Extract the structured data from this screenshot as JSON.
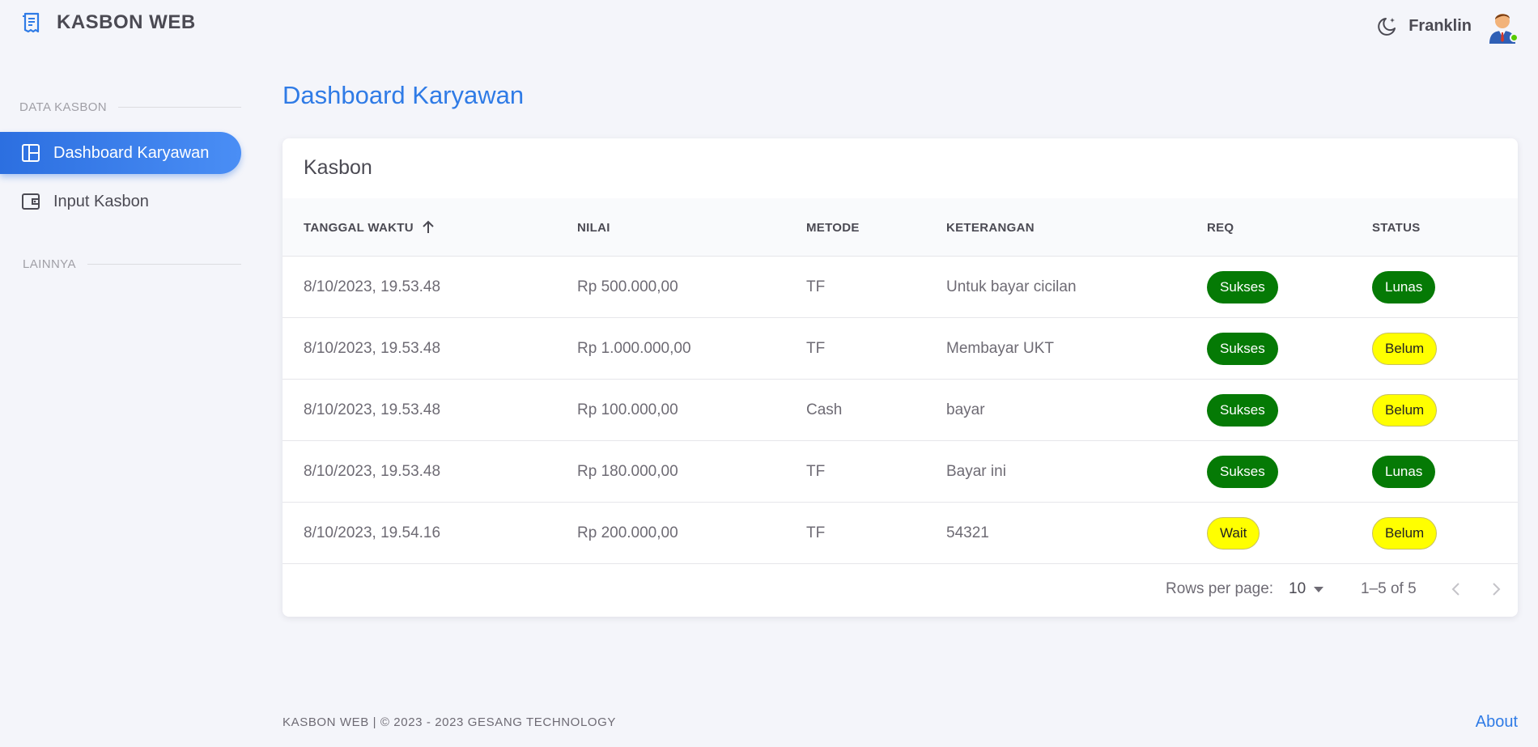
{
  "app": {
    "title": "KASBON WEB"
  },
  "user": {
    "name": "Franklin",
    "status_color": "#56ca00"
  },
  "sidebar": {
    "sections": [
      {
        "title": "DATA KASBON"
      },
      {
        "title": "LAINNYA"
      }
    ],
    "items": [
      {
        "label": "Dashboard Karyawan",
        "icon": "dashboard-icon",
        "active": true
      },
      {
        "label": "Input Kasbon",
        "icon": "wallet-icon",
        "active": false
      }
    ]
  },
  "page": {
    "title": "Dashboard Karyawan"
  },
  "table": {
    "title": "Kasbon",
    "columns": [
      "TANGGAL WAKTU",
      "NILAI",
      "METODE",
      "KETERANGAN",
      "REQ",
      "STATUS"
    ],
    "sort": {
      "column": "TANGGAL WAKTU",
      "direction": "asc"
    },
    "rows": [
      {
        "tanggal": "8/10/2023, 19.53.48",
        "nilai": "Rp 500.000,00",
        "metode": "TF",
        "keterangan": "Untuk bayar cicilan",
        "req": "Sukses",
        "status": "Lunas"
      },
      {
        "tanggal": "8/10/2023, 19.53.48",
        "nilai": "Rp 1.000.000,00",
        "metode": "TF",
        "keterangan": "Membayar UKT",
        "req": "Sukses",
        "status": "Belum"
      },
      {
        "tanggal": "8/10/2023, 19.53.48",
        "nilai": "Rp 100.000,00",
        "metode": "Cash",
        "keterangan": "bayar",
        "req": "Sukses",
        "status": "Belum"
      },
      {
        "tanggal": "8/10/2023, 19.53.48",
        "nilai": "Rp 180.000,00",
        "metode": "TF",
        "keterangan": "Bayar ini",
        "req": "Sukses",
        "status": "Lunas"
      },
      {
        "tanggal": "8/10/2023, 19.54.16",
        "nilai": "Rp 200.000,00",
        "metode": "TF",
        "keterangan": "54321",
        "req": "Wait",
        "status": "Belum"
      }
    ],
    "pagination": {
      "rows_per_page_label": "Rows per page:",
      "rows_per_page": "10",
      "range": "1–5 of 5"
    }
  },
  "chip_colors": {
    "green": "#057a05",
    "yellow": "#ffff00"
  },
  "accent_color": "#2f7be6",
  "footer": {
    "text": "KASBON WEB | © 2023 - 2023 GESANG TECHNOLOGY",
    "about_label": "About"
  }
}
